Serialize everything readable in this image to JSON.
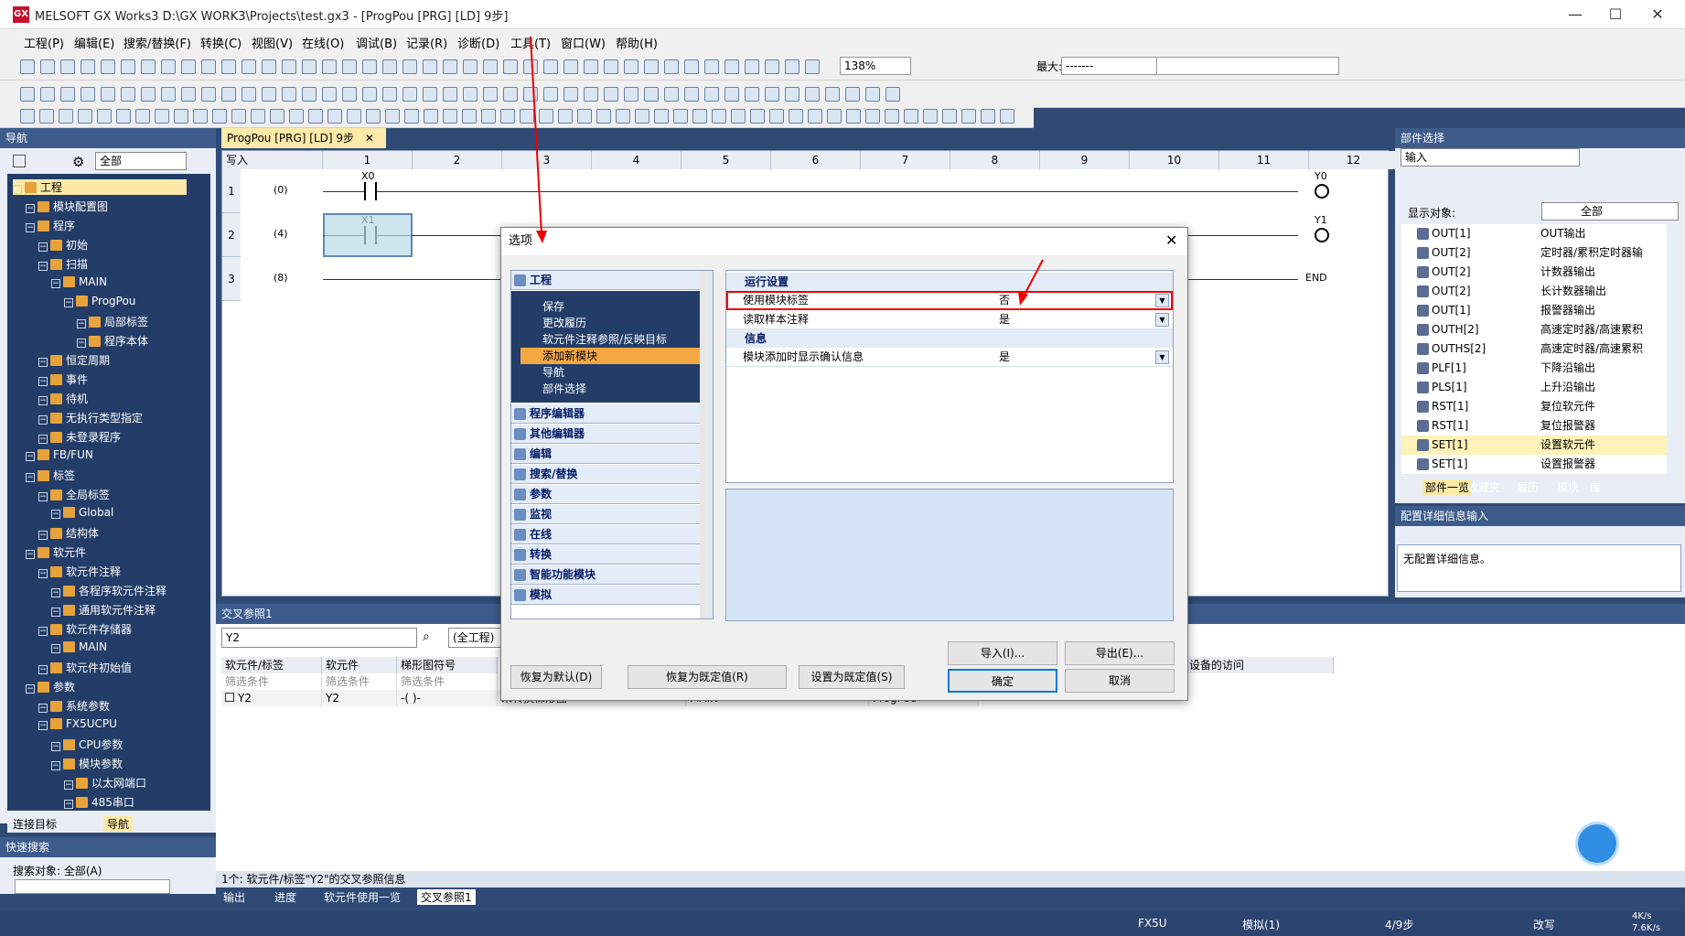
{
  "window": {
    "title": "MELSOFT GX Works3 D:\\GX WORK3\\Projects\\test.gx3 - [ProgPou [PRG] [LD] 9步]",
    "logo": "GX"
  },
  "menu": [
    "工程(P)",
    "编辑(E)",
    "搜索/替换(F)",
    "转换(C)",
    "视图(V)",
    "在线(O)",
    "调试(B)",
    "记录(R)",
    "诊断(D)",
    "工具(T)",
    "窗口(W)",
    "帮助(H)"
  ],
  "toolbar": {
    "zoom": "138%",
    "max_label": "最大:",
    "max_value": "-------"
  },
  "nav": {
    "title": "导航",
    "filter": "全部",
    "tree": [
      {
        "label": "工程",
        "level": 0,
        "sel": true
      },
      {
        "label": "模块配置图",
        "level": 1
      },
      {
        "label": "程序",
        "level": 1
      },
      {
        "label": "初始",
        "level": 2
      },
      {
        "label": "扫描",
        "level": 2
      },
      {
        "label": "MAIN",
        "level": 3
      },
      {
        "label": "ProgPou",
        "level": 4
      },
      {
        "label": "局部标签",
        "level": 5
      },
      {
        "label": "程序本体",
        "level": 5
      },
      {
        "label": "恒定周期",
        "level": 2
      },
      {
        "label": "事件",
        "level": 2
      },
      {
        "label": "待机",
        "level": 2
      },
      {
        "label": "无执行类型指定",
        "level": 2
      },
      {
        "label": "未登录程序",
        "level": 2
      },
      {
        "label": "FB/FUN",
        "level": 1
      },
      {
        "label": "标签",
        "level": 1
      },
      {
        "label": "全局标签",
        "level": 2
      },
      {
        "label": "Global",
        "level": 3
      },
      {
        "label": "结构体",
        "level": 2
      },
      {
        "label": "软元件",
        "level": 1
      },
      {
        "label": "软元件注释",
        "level": 2
      },
      {
        "label": "各程序软元件注释",
        "level": 3
      },
      {
        "label": "通用软元件注释",
        "level": 3
      },
      {
        "label": "软元件存储器",
        "level": 2
      },
      {
        "label": "MAIN",
        "level": 3
      },
      {
        "label": "软元件初始值",
        "level": 2
      },
      {
        "label": "参数",
        "level": 1
      },
      {
        "label": "系统参数",
        "level": 2
      },
      {
        "label": "FX5UCPU",
        "level": 2
      },
      {
        "label": "CPU参数",
        "level": 3
      },
      {
        "label": "模块参数",
        "level": 3
      },
      {
        "label": "以太网端口",
        "level": 4
      },
      {
        "label": "485串口",
        "level": 4
      }
    ],
    "tabs": [
      "连接目标",
      "导航"
    ],
    "quick_search": {
      "title": "快速搜索",
      "target": "搜索对象: 全部(A)"
    }
  },
  "editor_tab": "ProgPou [PRG] [LD] 9步",
  "ladder": {
    "mode": "写入",
    "columns": [
      "1",
      "2",
      "3",
      "4",
      "5",
      "6",
      "7",
      "8",
      "9",
      "10",
      "11",
      "12"
    ],
    "rows": [
      {
        "n": "1",
        "step": "(0)",
        "contact": "X0",
        "coil": "Y0"
      },
      {
        "n": "2",
        "step": "(4)",
        "contact": "X1",
        "coil": "Y1"
      },
      {
        "n": "3",
        "step": "(8)",
        "end": "END"
      }
    ]
  },
  "dialog": {
    "title": "选项",
    "categories": [
      {
        "label": "工程",
        "expanded": true,
        "children": [
          "保存",
          "更改履历",
          "软元件注释参照/反映目标",
          "添加新模块",
          "导航",
          "部件选择"
        ],
        "selected_child": "添加新模块"
      },
      {
        "label": "程序编辑器"
      },
      {
        "label": "其他编辑器"
      },
      {
        "label": "编辑"
      },
      {
        "label": "搜索/替换"
      },
      {
        "label": "参数"
      },
      {
        "label": "监视"
      },
      {
        "label": "在线"
      },
      {
        "label": "转换"
      },
      {
        "label": "智能功能模块"
      },
      {
        "label": "模拟"
      }
    ],
    "groups": [
      {
        "label": "运行设置",
        "items": [
          {
            "key": "使用模块标签",
            "value": "否"
          },
          {
            "key": "读取样本注释",
            "value": "是"
          }
        ]
      },
      {
        "label": "信息",
        "items": [
          {
            "key": "模块添加时显示确认信息",
            "value": "是"
          }
        ]
      }
    ],
    "buttons": {
      "import": "导入(I)...",
      "export": "导出(E)...",
      "restore_default": "恢复为默认(D)",
      "restore_preset": "恢复为既定值(R)",
      "set_preset": "设置为既定值(S)",
      "ok": "确定",
      "cancel": "取消"
    }
  },
  "parts": {
    "title": "部件选择",
    "search": "输入",
    "display_label": "显示对象:",
    "display_value": "全部",
    "items": [
      {
        "name": "OUT[1]",
        "desc": "OUT输出"
      },
      {
        "name": "OUT[2]",
        "desc": "定时器/累积定时器输"
      },
      {
        "name": "OUT[2]",
        "desc": "计数器输出"
      },
      {
        "name": "OUT[2]",
        "desc": "长计数器输出"
      },
      {
        "name": "OUT[1]",
        "desc": "报警器输出"
      },
      {
        "name": "OUTH[2]",
        "desc": "高速定时器/高速累积"
      },
      {
        "name": "OUTHS[2]",
        "desc": "高速定时器/高速累积"
      },
      {
        "name": "PLF[1]",
        "desc": "下降沿输出"
      },
      {
        "name": "PLS[1]",
        "desc": "上升沿输出"
      },
      {
        "name": "RST[1]",
        "desc": "复位软元件"
      },
      {
        "name": "RST[1]",
        "desc": "复位报警器"
      },
      {
        "name": "SET[1]",
        "desc": "设置软元件"
      },
      {
        "name": "SET[1]",
        "desc": "设置报警器"
      }
    ],
    "tabs": [
      "部件一览",
      "收藏夹",
      "履历",
      "模块",
      "库"
    ],
    "config_title": "配置详细信息输入",
    "config_text": "无配置详细信息。"
  },
  "xref": {
    "title": "交叉参照1",
    "device": "Y2",
    "scope": "(全工程)",
    "headers": [
      "软元件/标签",
      "软元件",
      "梯形图符号",
      "设备的访问"
    ],
    "filter": "筛选条件",
    "row": [
      "Y2",
      "Y2",
      "-( )-",
      "未转换梯形图",
      "MAIN",
      "ProgPou"
    ],
    "status": "1个: 软元件/标签\"Y2\"的交叉参照信息",
    "bottom_tabs": [
      "输出",
      "进度",
      "软元件使用一览",
      "交叉参照1"
    ]
  },
  "statusbar": {
    "cpu": "FX5U",
    "mode": "模拟(1)",
    "steps": "4/9步",
    "ovr": "改写"
  },
  "net": {
    "up": "4K/s",
    "down": "7.6K/s"
  }
}
